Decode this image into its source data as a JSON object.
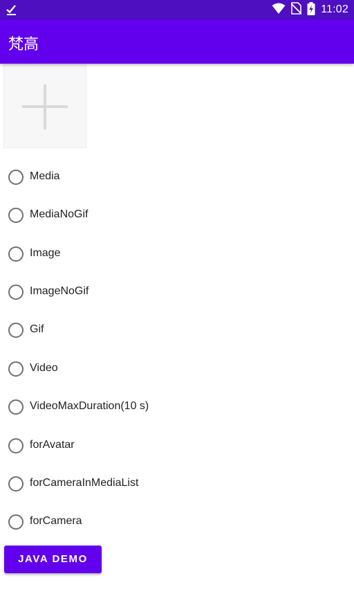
{
  "status_bar": {
    "time": "11:02",
    "left_icon": "download-done-icon",
    "icons": [
      "wifi-icon",
      "no-sim-icon",
      "battery-charging-icon"
    ],
    "background": "#4d0fbf"
  },
  "app_bar": {
    "title": "梵高",
    "background": "#6200ee"
  },
  "add_image_tile": {
    "icon": "plus-icon"
  },
  "options": [
    {
      "label": "Media",
      "checked": false
    },
    {
      "label": "MediaNoGif",
      "checked": false
    },
    {
      "label": "Image",
      "checked": false
    },
    {
      "label": "ImageNoGif",
      "checked": false
    },
    {
      "label": "Gif",
      "checked": false
    },
    {
      "label": "Video",
      "checked": false
    },
    {
      "label": "VideoMaxDuration(10 s)",
      "checked": false
    },
    {
      "label": "forAvatar",
      "checked": false
    },
    {
      "label": "forCameraInMediaList",
      "checked": false
    },
    {
      "label": "forCamera",
      "checked": false
    }
  ],
  "java_demo_button": {
    "label": "JAVA DEMO",
    "background": "#6200ee"
  }
}
